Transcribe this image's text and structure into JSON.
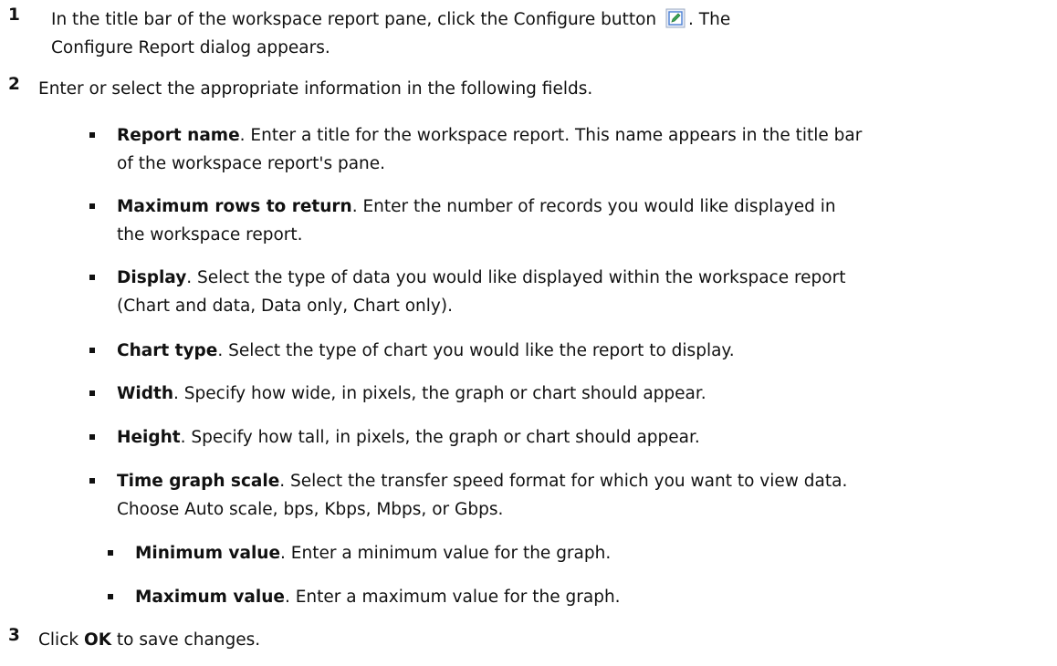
{
  "steps": [
    {
      "num": "1",
      "text_before": "In the title bar of the workspace report pane, click the Configure button ",
      "text_after": ". The",
      "line2": "Configure Report dialog appears."
    },
    {
      "num": "2",
      "text": "Enter or select the appropriate information in the following fields."
    },
    {
      "num": "3",
      "prefix": "Click ",
      "term": "OK",
      "suffix": " to save changes."
    }
  ],
  "fields": [
    {
      "term": "Report name",
      "line1": ". Enter a title for the workspace report. This name appears in the title bar",
      "line2": "of the workspace report's pane."
    },
    {
      "term": "Maximum rows to return",
      "line1": ". Enter the number of records you would like displayed in",
      "line2": "the workspace report."
    },
    {
      "term": "Display",
      "line1": ". Select the type of data you would like displayed within the workspace report",
      "line2": "(Chart and data, Data only, Chart only)."
    },
    {
      "term": "Chart type",
      "line1": ". Select the type of chart you would like the report to display."
    },
    {
      "term": "Width",
      "line1": ". Specify how wide, in pixels, the graph or chart should appear."
    },
    {
      "term": "Height",
      "line1": ". Specify how tall, in pixels, the graph or chart should appear."
    },
    {
      "term": "Time graph scale",
      "line1": ". Select the transfer speed format for which you want to view data.",
      "line2": "Choose Auto scale, bps, Kbps, Mbps, or Gbps."
    }
  ],
  "subfields": [
    {
      "term": "Minimum value",
      "line1": ". Enter a minimum value for the graph."
    },
    {
      "term": "Maximum value",
      "line1": ". Enter a maximum value for the graph."
    }
  ],
  "icons": {
    "configure": "edit-pencil-icon",
    "configure_color": "#3aa655",
    "configure_frame": "#4a7fd4"
  }
}
